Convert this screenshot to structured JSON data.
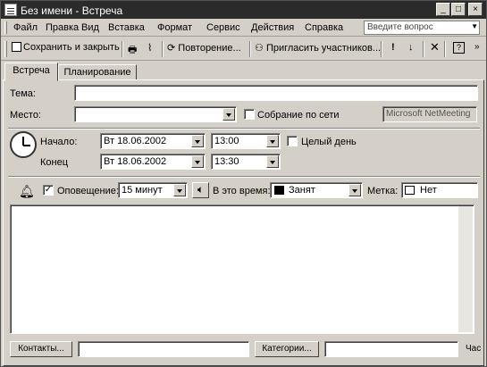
{
  "window": {
    "title": "Без имени - Встреча",
    "controls": [
      "_",
      "□",
      "×"
    ]
  },
  "menu": {
    "items": [
      "Файл",
      "Правка",
      "Вид",
      "Вставка",
      "Формат",
      "Сервис",
      "Действия",
      "Справка"
    ],
    "ask_placeholder": "Введите вопрос"
  },
  "toolbar": {
    "save_close": "Сохранить и закрыть",
    "recurrence": "Повторение...",
    "invite": "Пригласить участников..."
  },
  "tabs": [
    "Встреча",
    "Планирование"
  ],
  "form": {
    "subject_label": "Тема:",
    "subject_value": "",
    "location_label": "Место:",
    "location_value": "",
    "online_meeting_label": "Собрание по сети",
    "netmeeting_value": "Microsoft NetMeeting",
    "start_label": "Начало:",
    "start_date": "Вт 18.06.2002",
    "start_time": "13:00",
    "all_day_label": "Целый день",
    "end_label": "Конец",
    "end_date": "Вт 18.06.2002",
    "end_time": "13:30",
    "reminder_checked": true,
    "reminder_label": "Оповещение:",
    "reminder_value": "15 минут",
    "showas_label": "В это время:",
    "showas_value": "Занят",
    "label_label": "Метка:",
    "label_value": "Нет",
    "notes_value": ""
  },
  "footer": {
    "contacts_button": "Контакты...",
    "contacts_value": "",
    "categories_button": "Категории...",
    "categories_value": "",
    "private_label": "Час"
  }
}
